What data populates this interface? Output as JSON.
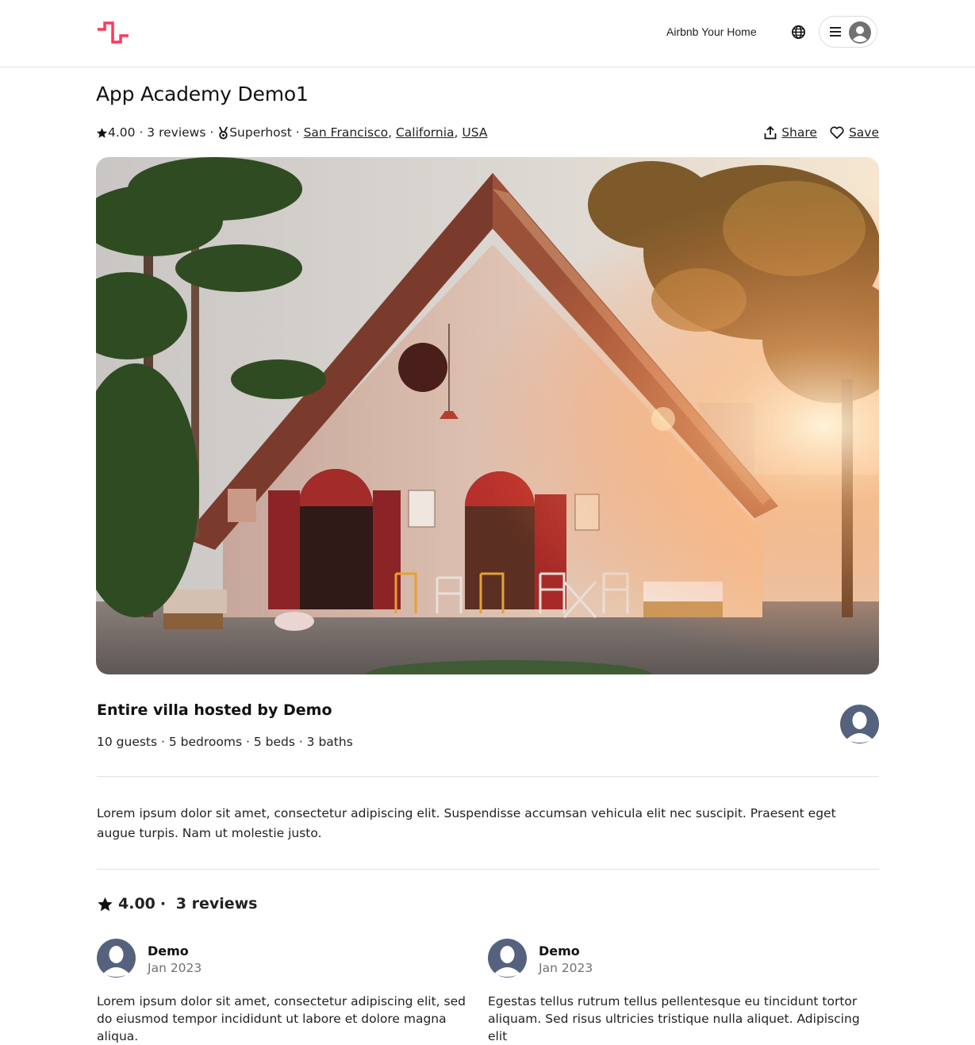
{
  "colors": {
    "brand": "#ff385c",
    "avatar": "#55627e",
    "text": "#222222",
    "muted": "#717171"
  },
  "header": {
    "logo_icon": "brand-logo-icon",
    "host_link": "Airbnb Your Home",
    "globe_icon": "globe-icon",
    "menu_icon": "hamburger-icon",
    "profile_icon": "user-avatar-icon"
  },
  "listing": {
    "title": "App Academy Demo1",
    "rating": "4.00",
    "reviews_label": "3 reviews",
    "superhost_label": "Superhost",
    "city": "San Francisco",
    "state": "California",
    "country": "USA",
    "share_label": "Share",
    "save_label": "Save",
    "photo_alt": "house"
  },
  "host": {
    "heading": "Entire villa hosted by Demo",
    "details": "10 guests · 5 bedrooms · 5 beds · 3 baths"
  },
  "description": "Lorem ipsum dolor sit amet, consectetur adipiscing elit. Suspendisse accumsan vehicula elit nec suscipit. Praesent eget augue turpis. Nam ut molestie justo.",
  "reviews_section": {
    "rating": "4.00",
    "count_label": "3 reviews",
    "items": [
      {
        "name": "Demo",
        "date": "Jan 2023",
        "text": "Lorem ipsum dolor sit amet, consectetur adipiscing elit, sed do eiusmod tempor incididunt ut labore et dolore magna aliqua."
      },
      {
        "name": "Demo",
        "date": "Jan 2023",
        "text": "Egestas tellus rutrum tellus pellentesque eu tincidunt tortor aliquam. Sed risus ultricies tristique nulla aliquet. Adipiscing elit"
      }
    ]
  }
}
